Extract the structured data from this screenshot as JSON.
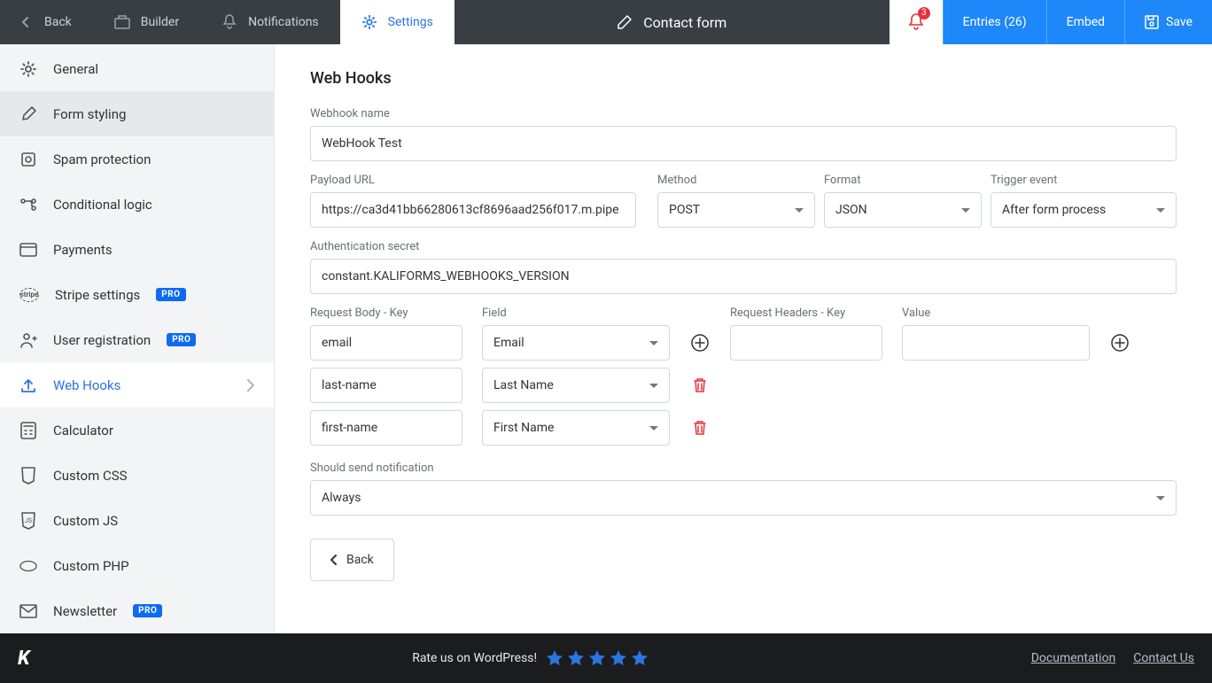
{
  "topbar": {
    "back": "Back",
    "builder": "Builder",
    "notifications": "Notifications",
    "settings": "Settings",
    "form_title": "Contact form",
    "alert_count": "3",
    "entries": "Entries (26)",
    "embed": "Embed",
    "save": "Save"
  },
  "sidebar": {
    "items": [
      {
        "label": "General"
      },
      {
        "label": "Form styling"
      },
      {
        "label": "Spam protection"
      },
      {
        "label": "Conditional logic"
      },
      {
        "label": "Payments"
      },
      {
        "label": "Stripe settings",
        "pro": "PRO"
      },
      {
        "label": "User registration",
        "pro": "PRO"
      },
      {
        "label": "Web Hooks"
      },
      {
        "label": "Calculator"
      },
      {
        "label": "Custom CSS"
      },
      {
        "label": "Custom JS"
      },
      {
        "label": "Custom PHP"
      },
      {
        "label": "Newsletter",
        "pro": "PRO"
      }
    ]
  },
  "page": {
    "title": "Web Hooks",
    "webhook_name_label": "Webhook name",
    "webhook_name": "WebHook Test",
    "payload_label": "Payload URL",
    "payload": "https://ca3d41bb66280613cf8696aad256f017.m.pipe",
    "method_label": "Method",
    "method": "POST",
    "format_label": "Format",
    "format": "JSON",
    "trigger_label": "Trigger event",
    "trigger": "After form process",
    "auth_label": "Authentication secret",
    "auth": "constant.KALIFORMS_WEBHOOKS_VERSION",
    "req_body_key_label": "Request Body - Key",
    "field_label": "Field",
    "req_header_key_label": "Request Headers - Key",
    "value_label": "Value",
    "rows": [
      {
        "key": "email",
        "field": "Email"
      },
      {
        "key": "last-name",
        "field": "Last Name"
      },
      {
        "key": "first-name",
        "field": "First Name"
      }
    ],
    "notify_label": "Should send notification",
    "notify": "Always",
    "back_btn": "Back"
  },
  "footer": {
    "rate": "Rate us on WordPress!",
    "doc": "Documentation",
    "contact": "Contact Us"
  }
}
